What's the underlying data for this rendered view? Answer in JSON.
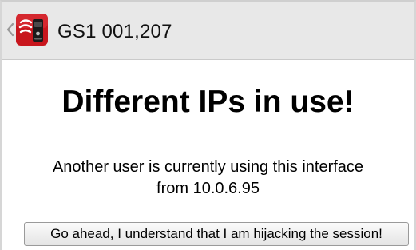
{
  "actionbar": {
    "back_icon": "chevron-left-icon",
    "app_icon": "device-app-icon",
    "title": "GS1 001,207"
  },
  "main": {
    "heading": "Different IPs in use!",
    "message_line1": "Another user is currently using this interface",
    "message_line2": "from 10.0.6.95",
    "button_label": "Go ahead, I understand that I am hijacking the session!"
  },
  "colors": {
    "actionbar_bg": "#e8e8e8",
    "icon_red": "#c8161d",
    "page_bg": "#ffffff"
  }
}
